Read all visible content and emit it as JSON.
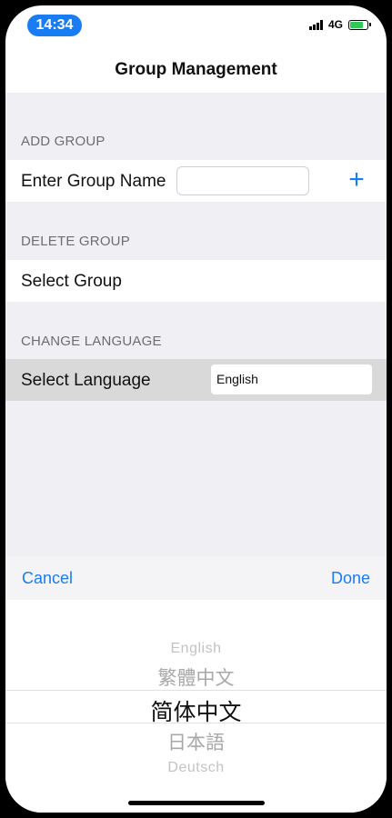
{
  "status_bar": {
    "time": "14:34",
    "network": "4G",
    "battery_color": "#31c759"
  },
  "nav": {
    "title": "Group Management"
  },
  "sections": {
    "add_group": {
      "header": "ADD GROUP",
      "row_label": "Enter Group Name",
      "input_value": "",
      "add_icon": "plus-icon"
    },
    "delete_group": {
      "header": "DELETE GROUP",
      "row_label": "Select Group"
    },
    "change_language": {
      "header": "CHANGE LANGUAGE",
      "row_label": "Select Language",
      "value": "English"
    }
  },
  "toolbar": {
    "cancel_label": "Cancel",
    "done_label": "Done"
  },
  "picker": {
    "options": [
      "English",
      "繁體中文",
      "简体中文",
      "日本語",
      "Deutsch"
    ],
    "selected": "简体中文"
  },
  "colors": {
    "accent": "#1a7cf3",
    "grouped_bg": "#efeff4"
  }
}
